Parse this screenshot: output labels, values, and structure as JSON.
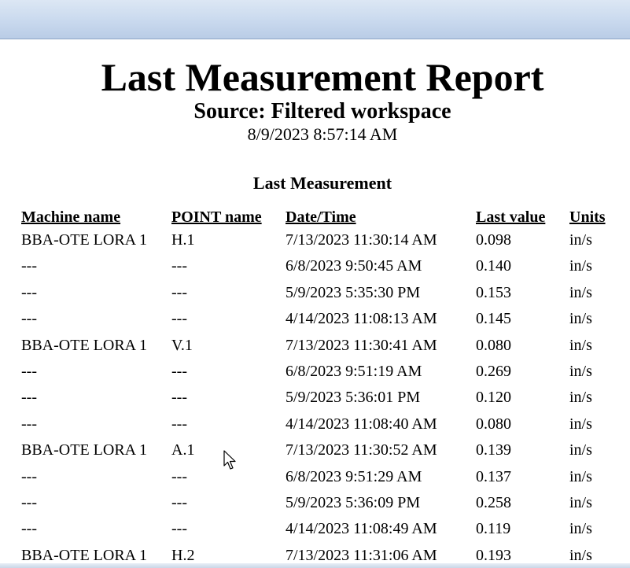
{
  "report": {
    "title": "Last Measurement Report",
    "subtitle": "Source: Filtered workspace",
    "timestamp": "8/9/2023 8:57:14 AM",
    "section_title": "Last Measurement"
  },
  "table": {
    "headers": {
      "machine": "Machine name",
      "point": "POINT name",
      "date": "Date/Time",
      "value": "Last value",
      "units": "Units"
    },
    "rows": [
      {
        "machine": "BBA-OTE LORA 1",
        "point": "H.1",
        "date": "7/13/2023 11:30:14 AM",
        "value": "0.098",
        "units": "in/s"
      },
      {
        "machine": "---",
        "point": "---",
        "date": "6/8/2023 9:50:45 AM",
        "value": "0.140",
        "units": "in/s"
      },
      {
        "machine": "---",
        "point": "---",
        "date": "5/9/2023 5:35:30 PM",
        "value": "0.153",
        "units": "in/s"
      },
      {
        "machine": "---",
        "point": "---",
        "date": "4/14/2023 11:08:13 AM",
        "value": "0.145",
        "units": "in/s"
      },
      {
        "machine": "BBA-OTE LORA 1",
        "point": "V.1",
        "date": "7/13/2023 11:30:41 AM",
        "value": "0.080",
        "units": "in/s"
      },
      {
        "machine": "---",
        "point": "---",
        "date": "6/8/2023 9:51:19 AM",
        "value": "0.269",
        "units": "in/s"
      },
      {
        "machine": "---",
        "point": "---",
        "date": "5/9/2023 5:36:01 PM",
        "value": "0.120",
        "units": "in/s"
      },
      {
        "machine": "---",
        "point": "---",
        "date": "4/14/2023 11:08:40 AM",
        "value": "0.080",
        "units": "in/s"
      },
      {
        "machine": "BBA-OTE LORA 1",
        "point": "A.1",
        "date": "7/13/2023 11:30:52 AM",
        "value": "0.139",
        "units": "in/s"
      },
      {
        "machine": "---",
        "point": "---",
        "date": "6/8/2023 9:51:29 AM",
        "value": "0.137",
        "units": "in/s"
      },
      {
        "machine": "---",
        "point": "---",
        "date": "5/9/2023 5:36:09 PM",
        "value": "0.258",
        "units": "in/s"
      },
      {
        "machine": "---",
        "point": "---",
        "date": "4/14/2023 11:08:49 AM",
        "value": "0.119",
        "units": "in/s"
      },
      {
        "machine": "BBA-OTE LORA 1",
        "point": "H.2",
        "date": "7/13/2023 11:31:06 AM",
        "value": "0.193",
        "units": "in/s"
      }
    ]
  },
  "icons": {
    "cursor": "mouse-pointer-icon"
  },
  "colors": {
    "window_bar": "#c9d9ee",
    "page_background": "#ffffff",
    "text": "#000000"
  }
}
